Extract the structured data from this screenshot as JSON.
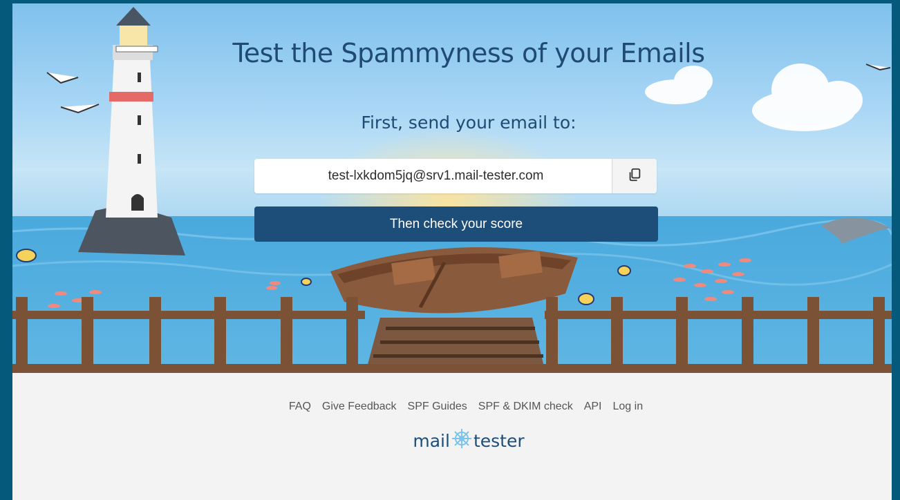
{
  "hero": {
    "title": "Test the Spammyness of your Emails",
    "subtitle": "First, send your email to:",
    "email": "test-lxkdom5jq@srv1.mail-tester.com",
    "copy_icon": "copy-icon",
    "check_button": "Then check your score"
  },
  "footer": {
    "links": [
      "FAQ",
      "Give Feedback",
      "SPF Guides",
      "SPF & DKIM check",
      "API",
      "Log in"
    ],
    "brand_left": "mail",
    "brand_right": "tester",
    "brand_icon": "ship-wheel-icon"
  },
  "colors": {
    "frame": "#055a7c",
    "primary": "#1d4e79",
    "title": "#1f4a73",
    "footer_bg": "#f3f3f3"
  }
}
